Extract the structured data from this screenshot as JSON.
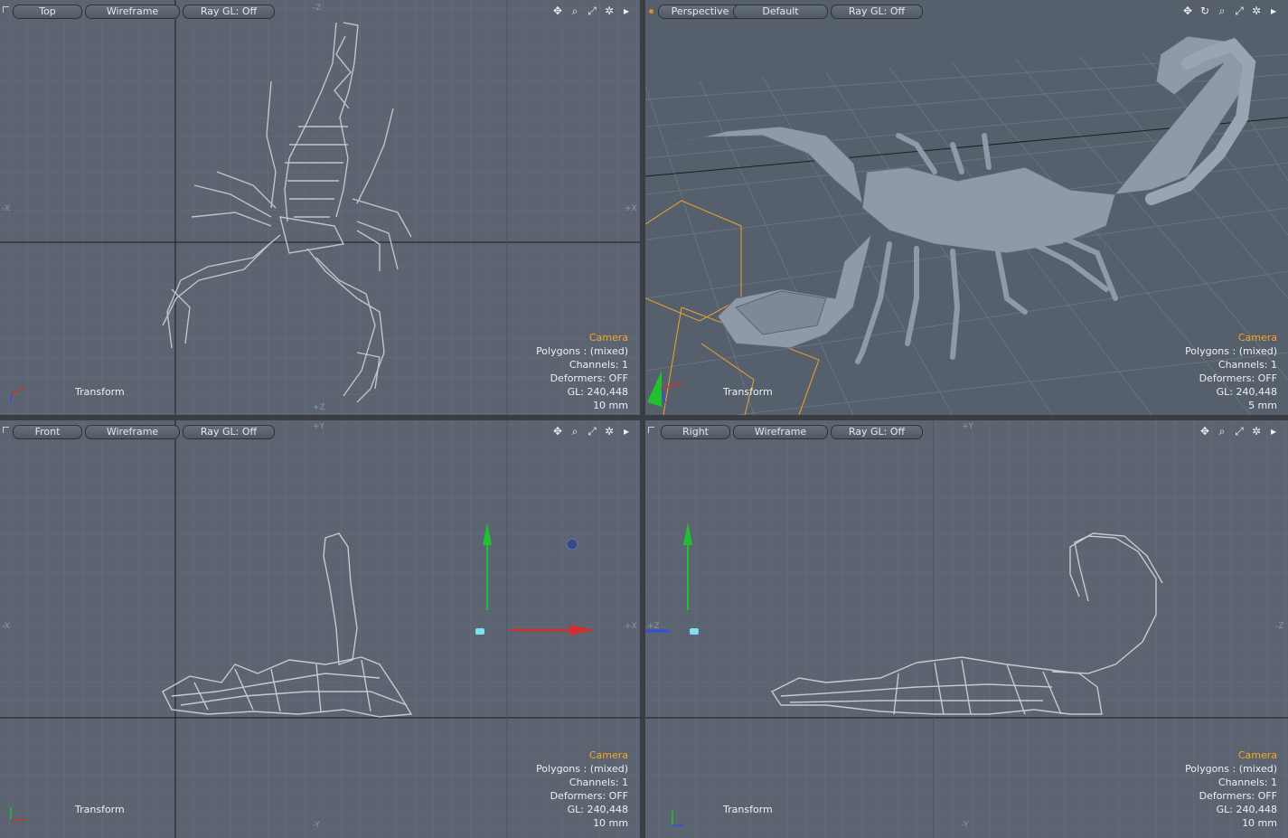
{
  "viewports": [
    {
      "id": "top",
      "view": "Top",
      "mode": "Wireframe",
      "raygl": "Ray GL: Off",
      "info": {
        "camera": "Camera",
        "polygons": "Polygons : (mixed)",
        "channels": "Channels: 1",
        "deformers": "Deformers: OFF",
        "gl": "GL: 240,448",
        "scale": "10 mm"
      },
      "transform": "Transform",
      "axes": {
        "top": "-Z",
        "bottom": "+Z",
        "left": "-X",
        "right": "+X"
      }
    },
    {
      "id": "perspective",
      "view": "Perspective",
      "mode": "Default",
      "raygl": "Ray GL: Off",
      "info": {
        "camera": "Camera",
        "polygons": "Polygons : (mixed)",
        "channels": "Channels: 1",
        "deformers": "Deformers: OFF",
        "gl": "GL: 240,448",
        "scale": "5 mm"
      },
      "transform": "Transform"
    },
    {
      "id": "front",
      "view": "Front",
      "mode": "Wireframe",
      "raygl": "Ray GL: Off",
      "info": {
        "camera": "Camera",
        "polygons": "Polygons : (mixed)",
        "channels": "Channels: 1",
        "deformers": "Deformers: OFF",
        "gl": "GL: 240,448",
        "scale": "10 mm"
      },
      "transform": "Transform",
      "axes": {
        "top": "+Y",
        "bottom": "-Y",
        "left": "-X",
        "right": "+X"
      }
    },
    {
      "id": "right",
      "view": "Right",
      "mode": "Wireframe",
      "raygl": "Ray GL: Off",
      "info": {
        "camera": "Camera",
        "polygons": "Polygons : (mixed)",
        "channels": "Channels: 1",
        "deformers": "Deformers: OFF",
        "gl": "GL: 240,448",
        "scale": "10 mm"
      },
      "transform": "Transform",
      "axes": {
        "top": "+Y",
        "bottom": "-Y",
        "left": "+Z",
        "right": "-Z"
      }
    }
  ],
  "toolbar_icons": [
    "move-view-icon",
    "rotate-view-icon",
    "zoom-view-icon",
    "fit-view-icon",
    "settings-gear-icon",
    "menu-arrow-icon"
  ],
  "colors": {
    "viewport_bg": "#5b6470",
    "camera_label": "#f5a623",
    "mesh": "#c8cacc",
    "x_axis": "#d03030",
    "y_axis": "#22c030",
    "z_axis": "#3050e0",
    "selection": "#f0a030"
  }
}
